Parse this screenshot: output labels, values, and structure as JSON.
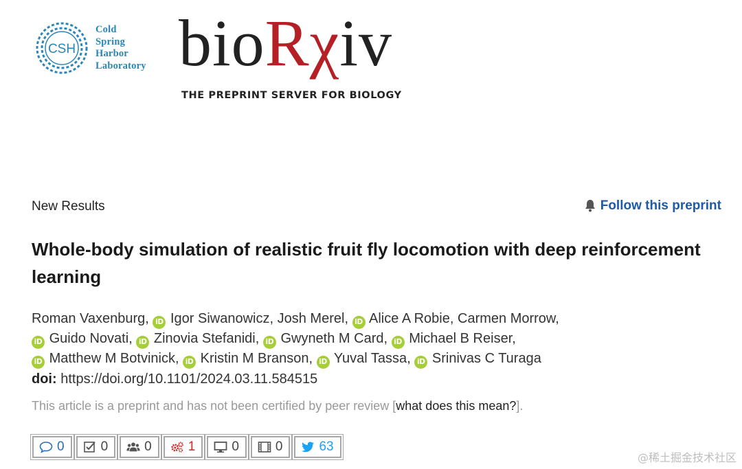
{
  "header": {
    "csh_emblem_text": "CSH",
    "csh_lines": [
      "Cold",
      "Spring",
      "Harbor",
      "Laboratory"
    ],
    "biorxiv_part1": "bio",
    "biorxiv_part2": "Rχ",
    "biorxiv_part3": "iv",
    "tagline": "THE PREPRINT SERVER FOR BIOLOGY"
  },
  "meta": {
    "section_label": "New Results",
    "follow_label": "Follow this preprint"
  },
  "article": {
    "title": "Whole-body simulation of realistic fruit fly locomotion with deep reinforcement learning",
    "orcid_badge": "iD",
    "authors": [
      "Roman Vaxenburg",
      "Igor Siwanowicz",
      "Josh Merel",
      "Alice A Robie",
      "Carmen Morrow",
      "Guido Novati",
      "Zinovia Stefanidi",
      "Gwyneth M Card",
      "Michael B Reiser",
      "Matthew M Botvinick",
      "Kristin M Branson",
      "Yuval Tassa",
      "Srinivas C Turaga"
    ],
    "doi_label": "doi:",
    "doi_value": "https://doi.org/10.1101/2024.03.11.584515",
    "disclaimer_text": "This article is a preprint and has not been certified by peer review [",
    "disclaimer_link": "what does this mean?",
    "disclaimer_end": "]."
  },
  "metrics": [
    {
      "icon": "comment-icon",
      "value": "0"
    },
    {
      "icon": "checklist-icon",
      "value": "0"
    },
    {
      "icon": "users-icon",
      "value": "0"
    },
    {
      "icon": "gears-icon",
      "value": "1"
    },
    {
      "icon": "monitor-icon",
      "value": "0"
    },
    {
      "icon": "film-icon",
      "value": "0"
    },
    {
      "icon": "twitter-icon",
      "value": "63"
    }
  ],
  "watermark": "@稀土掘金技术社区",
  "colors": {
    "brand_red": "#b42025",
    "link_blue": "#1d5aa8",
    "orcid_green": "#a6ce39",
    "csh_blue": "#2a86b8",
    "twitter_blue": "#1da1f2",
    "alert_red": "#d42424"
  }
}
